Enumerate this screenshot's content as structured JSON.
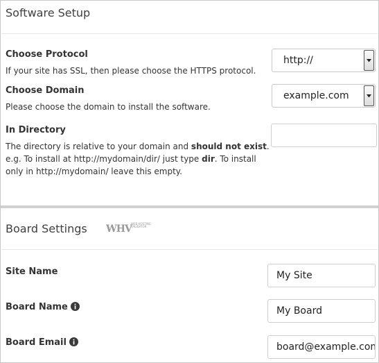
{
  "software_setup": {
    "title": "Software Setup",
    "protocol": {
      "label": "Choose Protocol",
      "description": "If your site has SSL, then please choose the HTTPS protocol.",
      "value": "http://"
    },
    "domain": {
      "label": "Choose Domain",
      "description": "Please choose the domain to install the software.",
      "value": "example.com"
    },
    "directory": {
      "label": "In Directory",
      "value": "",
      "description_parts": {
        "part1": "The directory is relative to your domain and ",
        "bold1": "should not exist",
        "part2": ". e.g. To install at http://mydomain/dir/ just type ",
        "bold2": "dir",
        "part3": ". To install only in http://mydomain/ leave this empty."
      }
    }
  },
  "board_settings": {
    "title": "Board Settings",
    "logo": {
      "text": "WHV",
      "sub_text": "WEB HOSTING VALIDATOR"
    },
    "site_name": {
      "label": "Site Name",
      "value": "My Site"
    },
    "board_name": {
      "label": "Board Name",
      "value": "My Board",
      "icon": "info-icon"
    },
    "board_email": {
      "label": "Board Email",
      "value": "board@example.com",
      "icon": "info-icon"
    }
  }
}
